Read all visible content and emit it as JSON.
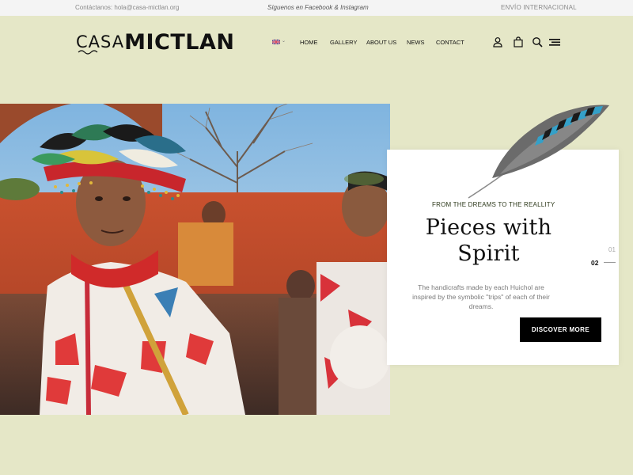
{
  "topbar": {
    "contact": "Contáctanos: hola@casa-mictlan.org",
    "social": "Síguenos en Facebook & Instagram",
    "shipping": "ENVÍO INTERNACIONAL"
  },
  "logo": {
    "part1": "CASA",
    "part2": "MICTLAN"
  },
  "nav": {
    "language": "en-flag-icon",
    "items": [
      "HOME",
      "GALLERY",
      "ABOUT US",
      "NEWS",
      "CONTACT"
    ]
  },
  "icons": [
    "user-icon",
    "shopping-bag-icon",
    "search-icon",
    "menu-icon"
  ],
  "hero": {
    "eyebrow": "FROM THE DREAMS TO THE REALLITY",
    "headline_line1": "Pieces with",
    "headline_line2": "Spirit",
    "description": "The handicrafts made by each Huichol are inspired by  the symbolic \"trips\" of each of their dreams.",
    "button": "DISCOVER MORE",
    "pager": {
      "inactive": "01",
      "active": "02"
    }
  },
  "colors": {
    "background": "#e5e7c7",
    "button": "#000000",
    "eyebrow": "#2e3a1c"
  }
}
